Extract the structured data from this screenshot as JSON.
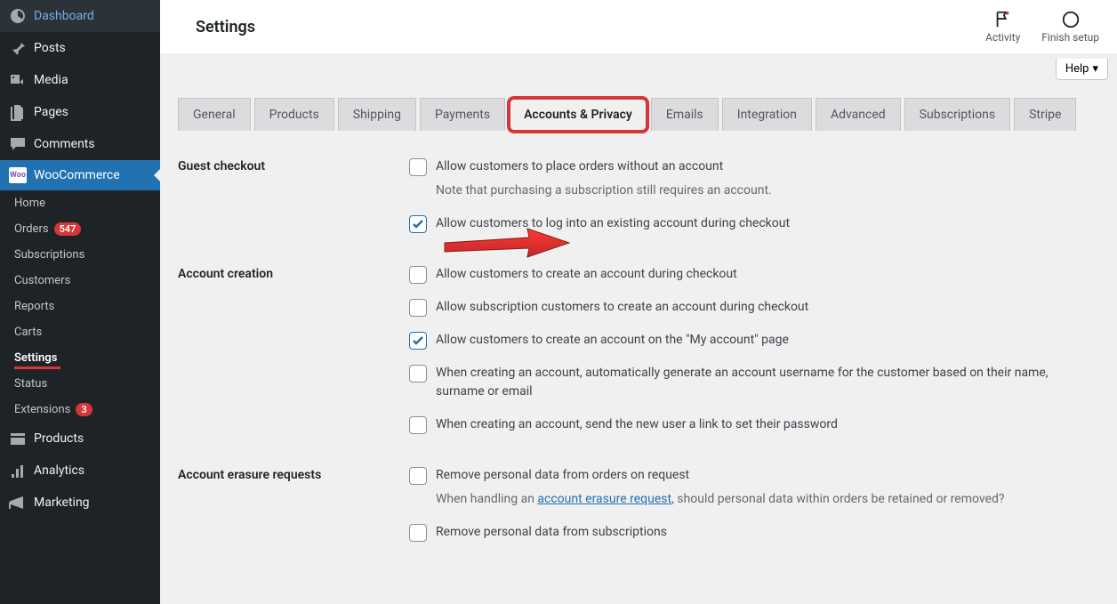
{
  "sidebar": {
    "main": [
      {
        "label": "Dashboard"
      },
      {
        "label": "Posts"
      },
      {
        "label": "Media"
      },
      {
        "label": "Pages"
      },
      {
        "label": "Comments"
      },
      {
        "label": "WooCommerce",
        "active": true
      },
      {
        "label": "Products"
      },
      {
        "label": "Analytics"
      },
      {
        "label": "Marketing"
      }
    ],
    "sub": [
      {
        "label": "Home"
      },
      {
        "label": "Orders",
        "badge": "547"
      },
      {
        "label": "Subscriptions"
      },
      {
        "label": "Customers"
      },
      {
        "label": "Reports"
      },
      {
        "label": "Carts"
      },
      {
        "label": "Settings",
        "current": true
      },
      {
        "label": "Status"
      },
      {
        "label": "Extensions",
        "badge": "3"
      }
    ]
  },
  "top": {
    "title": "Settings",
    "activity": "Activity",
    "finish": "Finish setup",
    "help": "Help"
  },
  "tabs": [
    "General",
    "Products",
    "Shipping",
    "Payments",
    "Accounts & Privacy",
    "Emails",
    "Integration",
    "Advanced",
    "Subscriptions",
    "Stripe"
  ],
  "activeTab": "Accounts & Privacy",
  "sections": {
    "guest": {
      "title": "Guest checkout",
      "opt1": "Allow customers to place orders without an account",
      "note1": "Note that purchasing a subscription still requires an account.",
      "opt2": "Allow customers to log into an existing account during checkout"
    },
    "account": {
      "title": "Account creation",
      "opt1": "Allow customers to create an account during checkout",
      "opt2": "Allow subscription customers to create an account during checkout",
      "opt3": "Allow customers to create an account on the \"My account\" page",
      "opt4": "When creating an account, automatically generate an account username for the customer based on their name, surname or email",
      "opt5": "When creating an account, send the new user a link to set their password"
    },
    "erasure": {
      "title": "Account erasure requests",
      "opt1": "Remove personal data from orders on request",
      "note1_a": "When handling an ",
      "note1_link": "account erasure request",
      "note1_b": ", should personal data within orders be retained or removed?",
      "opt2": "Remove personal data from subscriptions"
    }
  }
}
